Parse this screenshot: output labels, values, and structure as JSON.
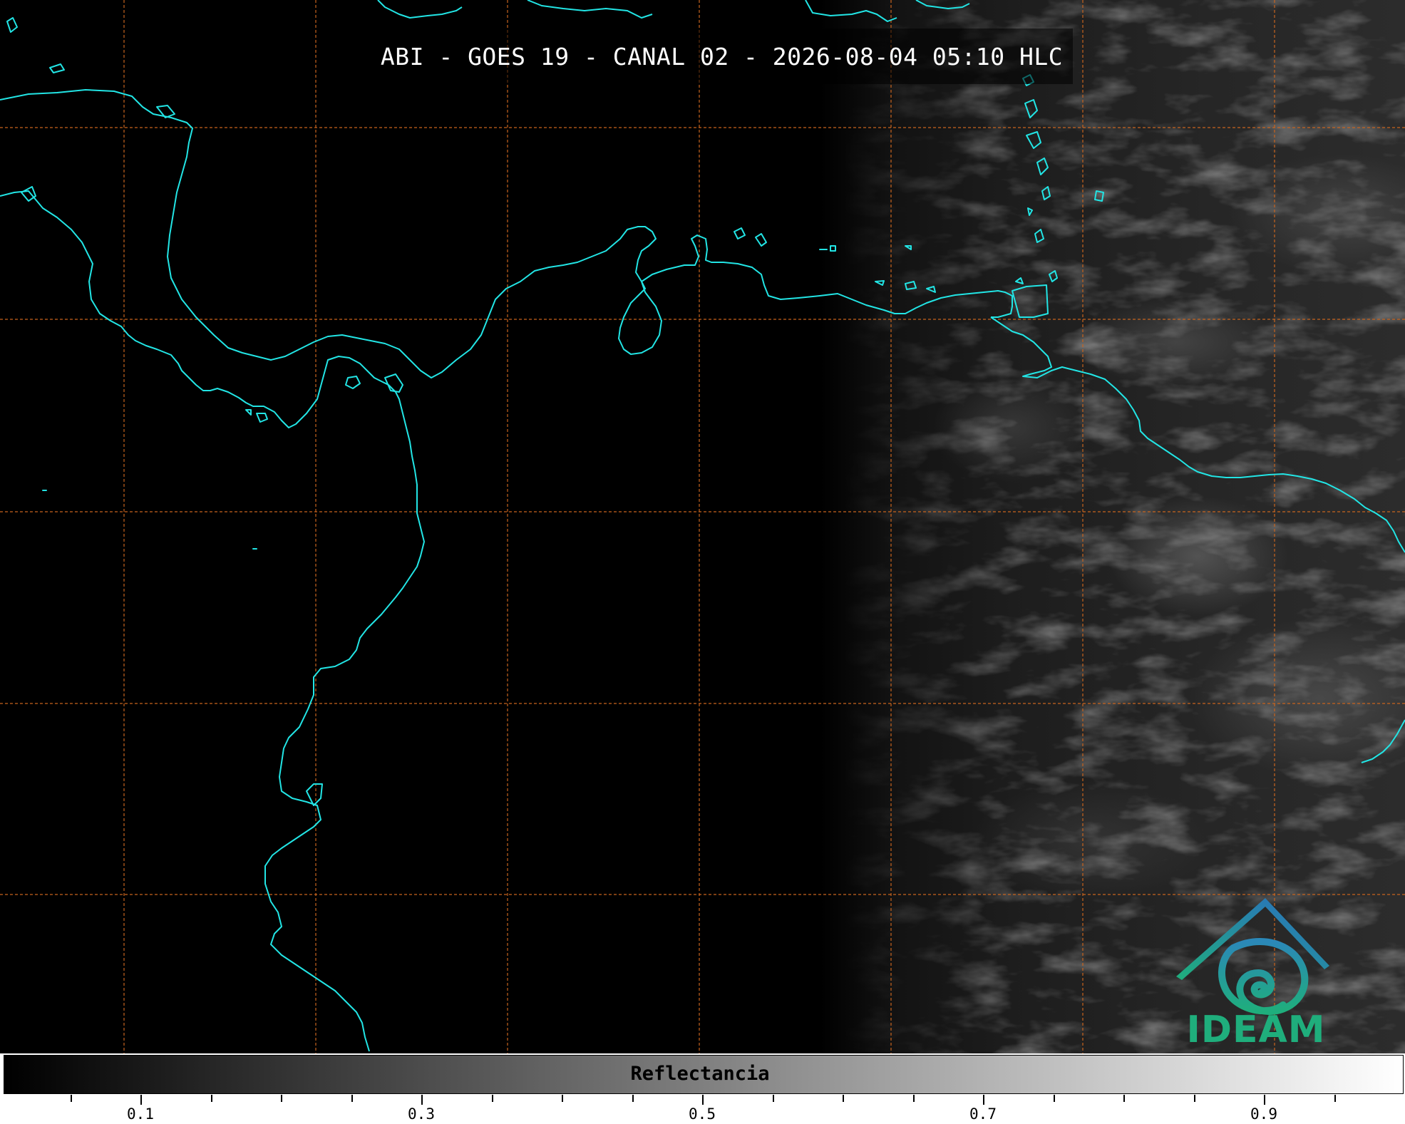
{
  "title": "ABI - GOES 19 - CANAL 02 - 2026-08-04 05:10 HLC",
  "colorbar": {
    "label": "Reflectancia",
    "ticks": [
      "0.1",
      "0.3",
      "0.5",
      "0.7",
      "0.9"
    ],
    "min": 0.0,
    "max": 1.0,
    "colormap": "grayscale black-to-white"
  },
  "logo": {
    "text": "IDEAM"
  },
  "colors": {
    "coastline": "#22e5e5",
    "gridlines": "#c8641e",
    "logo_blue": "#2b6cc4",
    "logo_green": "#1fae7c"
  },
  "map": {
    "gridlines": "dashed",
    "terminator": "day-night boundary (night west, day east)"
  }
}
